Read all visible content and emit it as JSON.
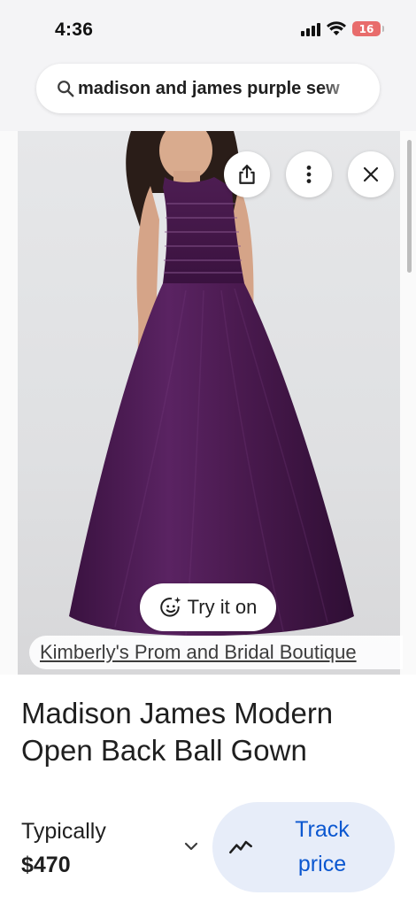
{
  "status_bar": {
    "time": "4:36",
    "battery_level": "16",
    "battery_color": "#e86c6c"
  },
  "search": {
    "query": "madison and james purple sew",
    "icon": "search-icon"
  },
  "viewer": {
    "buttons": [
      "share-icon",
      "more-vert-icon",
      "close-icon"
    ],
    "try_on_label": "Try it on",
    "source": "Kimberly's Prom and Bridal Boutique",
    "dress_color": "#4a1a4f"
  },
  "product": {
    "title": "Madison James Modern Open Back Ball Gown",
    "price_label": "Typically",
    "price_value": "$470",
    "track_label": "Track price",
    "accent": "#0b57d0"
  }
}
